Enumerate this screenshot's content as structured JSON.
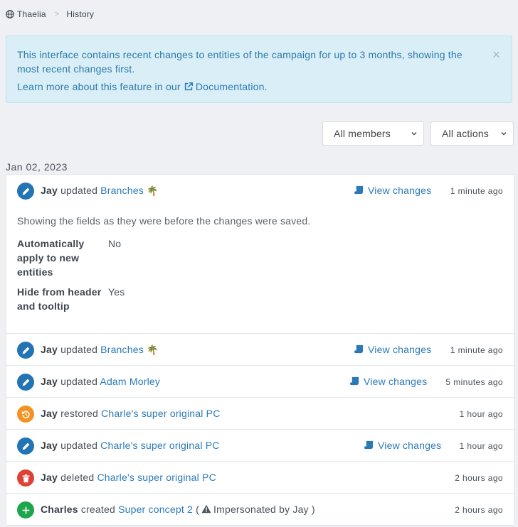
{
  "breadcrumb": {
    "campaign": "Thaelia",
    "separator": ">",
    "page": "History"
  },
  "alert": {
    "text": "This interface contains recent changes to entities of the campaign for up to 3 months, showing the most recent changes first.",
    "learn_prefix": "Learn more about this feature in our",
    "doc_link": "Documentation",
    "learn_suffix": ".",
    "close": "×"
  },
  "filters": {
    "members": "All members",
    "actions": "All actions"
  },
  "date_header": "Jan 02, 2023",
  "view_changes_label": "View changes",
  "rows": [
    {
      "user": "Jay",
      "verb": "updated",
      "entity": "Branches",
      "emoji": "🌴",
      "time": "1 minute ago",
      "icon": "pencil-icon",
      "color": "#2274b5",
      "details": {
        "intro": "Showing the fields as they were before the changes were saved.",
        "fields": [
          {
            "label": "Automatically apply to new entities",
            "value": "No"
          },
          {
            "label": "Hide from header and tooltip",
            "value": "Yes"
          }
        ]
      }
    },
    {
      "user": "Jay",
      "verb": "updated",
      "entity": "Branches",
      "emoji": "🌴",
      "time": "1 minute ago",
      "icon": "pencil-icon",
      "color": "#2274b5"
    },
    {
      "user": "Jay",
      "verb": "updated",
      "entity": "Adam Morley",
      "time": "5 minutes ago",
      "icon": "pencil-icon",
      "color": "#2274b5"
    },
    {
      "user": "Jay",
      "verb": "restored",
      "entity": "Charle's super original PC",
      "time": "1 hour ago",
      "icon": "history-icon",
      "color": "#f39324"
    },
    {
      "user": "Jay",
      "verb": "updated",
      "entity": "Charle's super original PC",
      "time": "1 hour ago",
      "icon": "pencil-icon",
      "color": "#2274b5"
    },
    {
      "user": "Jay",
      "verb": "deleted",
      "entity": "Charle's super original PC",
      "time": "2 hours ago",
      "icon": "trash-icon",
      "color": "#dd4234"
    },
    {
      "user": "Charles",
      "verb": "created",
      "entity": "Super concept 2",
      "open_paren": "(",
      "impersonated": "Impersonated by Jay",
      "close_paren": ")",
      "time": "2 hours ago",
      "icon": "plus-icon",
      "color": "#1fa54b"
    }
  ]
}
